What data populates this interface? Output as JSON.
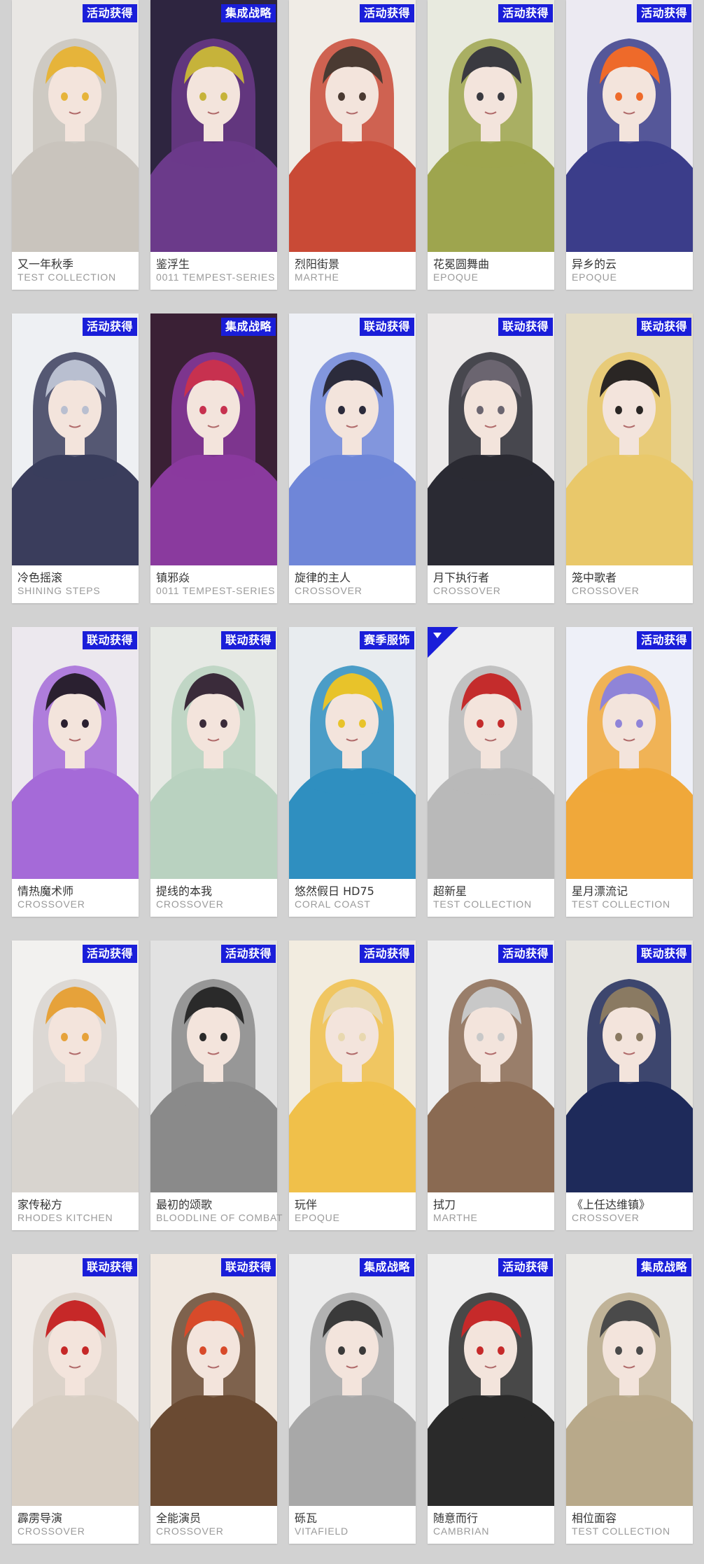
{
  "cards": [
    {
      "badge": "活动获得",
      "name": "又一年秋季",
      "series": "TEST COLLECTION",
      "palette": [
        "#e9e7e4",
        "#c9c4bd",
        "#e6b43a"
      ]
    },
    {
      "badge": "集成战略",
      "name": "鉴浮生",
      "series": "0011 TEMPEST-SERIES",
      "palette": [
        "#2e2540",
        "#6b3a8a",
        "#c6b33a"
      ]
    },
    {
      "badge": "活动获得",
      "name": "烈阳街景",
      "series": "MARTHE",
      "palette": [
        "#f0ece6",
        "#c94a36",
        "#4a3a32"
      ]
    },
    {
      "badge": "活动获得",
      "name": "花冕圆舞曲",
      "series": "EPOQUE",
      "palette": [
        "#e8eadf",
        "#9ea54e",
        "#3a3a40"
      ]
    },
    {
      "badge": "活动获得",
      "name": "异乡的云",
      "series": "EPOQUE",
      "palette": [
        "#eceaf2",
        "#3b3d8a",
        "#ee6a2a"
      ]
    },
    {
      "badge": "活动获得",
      "name": "冷色摇滚",
      "series": "SHINING STEPS",
      "palette": [
        "#eef0f3",
        "#3a3d5c",
        "#b9bfd0"
      ]
    },
    {
      "badge": "集成战略",
      "name": "镇邪焱",
      "series": "0011 TEMPEST-SERIES",
      "palette": [
        "#3a2035",
        "#8a3a9e",
        "#c7314f"
      ]
    },
    {
      "badge": "联动获得",
      "name": "旋律的主人",
      "series": "CROSSOVER",
      "palette": [
        "#eef0f6",
        "#6f86d8",
        "#2b2b3b"
      ]
    },
    {
      "badge": "联动获得",
      "name": "月下执行者",
      "series": "CROSSOVER",
      "palette": [
        "#eceaea",
        "#2a2a33",
        "#6b6570"
      ]
    },
    {
      "badge": "联动获得",
      "name": "笼中歌者",
      "series": "CROSSOVER",
      "palette": [
        "#e4ddc6",
        "#e9c86a",
        "#2a2624"
      ]
    },
    {
      "badge": "联动获得",
      "name": "情热魔术师",
      "series": "CROSSOVER",
      "palette": [
        "#ece8ee",
        "#a56ad8",
        "#2a2030"
      ]
    },
    {
      "badge": "联动获得",
      "name": "提线的本我",
      "series": "CROSSOVER",
      "palette": [
        "#e6e9e4",
        "#b9d2c0",
        "#3a2b3a"
      ]
    },
    {
      "badge": "赛季服饰",
      "name": "悠然假日 HD75",
      "series": "CORAL COAST",
      "palette": [
        "#e8ecef",
        "#2f8fc0",
        "#e8c32a"
      ]
    },
    {
      "badge": "",
      "name": "超新星",
      "series": "TEST COLLECTION",
      "palette": [
        "#eeeeee",
        "#b9b9b9",
        "#c42c2c"
      ]
    },
    {
      "badge": "活动获得",
      "name": "星月漂流记",
      "series": "TEST COLLECTION",
      "palette": [
        "#eef0f8",
        "#f0a83a",
        "#8f84d8"
      ]
    },
    {
      "badge": "活动获得",
      "name": "家传秘方",
      "series": "RHODES KITCHEN",
      "palette": [
        "#f2f1ef",
        "#d8d4cf",
        "#e6a23a"
      ]
    },
    {
      "badge": "活动获得",
      "name": "最初的颂歌",
      "series": "BLOODLINE OF COMBAT",
      "palette": [
        "#e2e2e2",
        "#8a8a8a",
        "#2a2a2a"
      ]
    },
    {
      "badge": "活动获得",
      "name": "玩伴",
      "series": "EPOQUE",
      "palette": [
        "#f2ece0",
        "#f0c04a",
        "#e8d8b0"
      ]
    },
    {
      "badge": "活动获得",
      "name": "拭刀",
      "series": "MARTHE",
      "palette": [
        "#eeeeee",
        "#8a6a52",
        "#c8c8c8"
      ]
    },
    {
      "badge": "联动获得",
      "name": "《上任达维镇》",
      "series": "CROSSOVER",
      "palette": [
        "#e6e4de",
        "#1e2a5a",
        "#8a7a62"
      ]
    },
    {
      "badge": "联动获得",
      "name": "霹雳导演",
      "series": "CROSSOVER",
      "palette": [
        "#efeae6",
        "#d8cfc4",
        "#c62828"
      ]
    },
    {
      "badge": "联动获得",
      "name": "全能演员",
      "series": "CROSSOVER",
      "palette": [
        "#f0e8e0",
        "#6a4a32",
        "#d84a2a"
      ]
    },
    {
      "badge": "集成战略",
      "name": "砾瓦",
      "series": "VITAFIELD",
      "palette": [
        "#ececec",
        "#a8a8a8",
        "#3a3a3a"
      ]
    },
    {
      "badge": "活动获得",
      "name": "随意而行",
      "series": "CAMBRIAN",
      "palette": [
        "#eeeeee",
        "#2a2a2a",
        "#c62a2a"
      ]
    },
    {
      "badge": "集成战略",
      "name": "相位面容",
      "series": "TEST COLLECTION",
      "palette": [
        "#ecebe8",
        "#b8a98a",
        "#4a4a4a"
      ]
    }
  ]
}
